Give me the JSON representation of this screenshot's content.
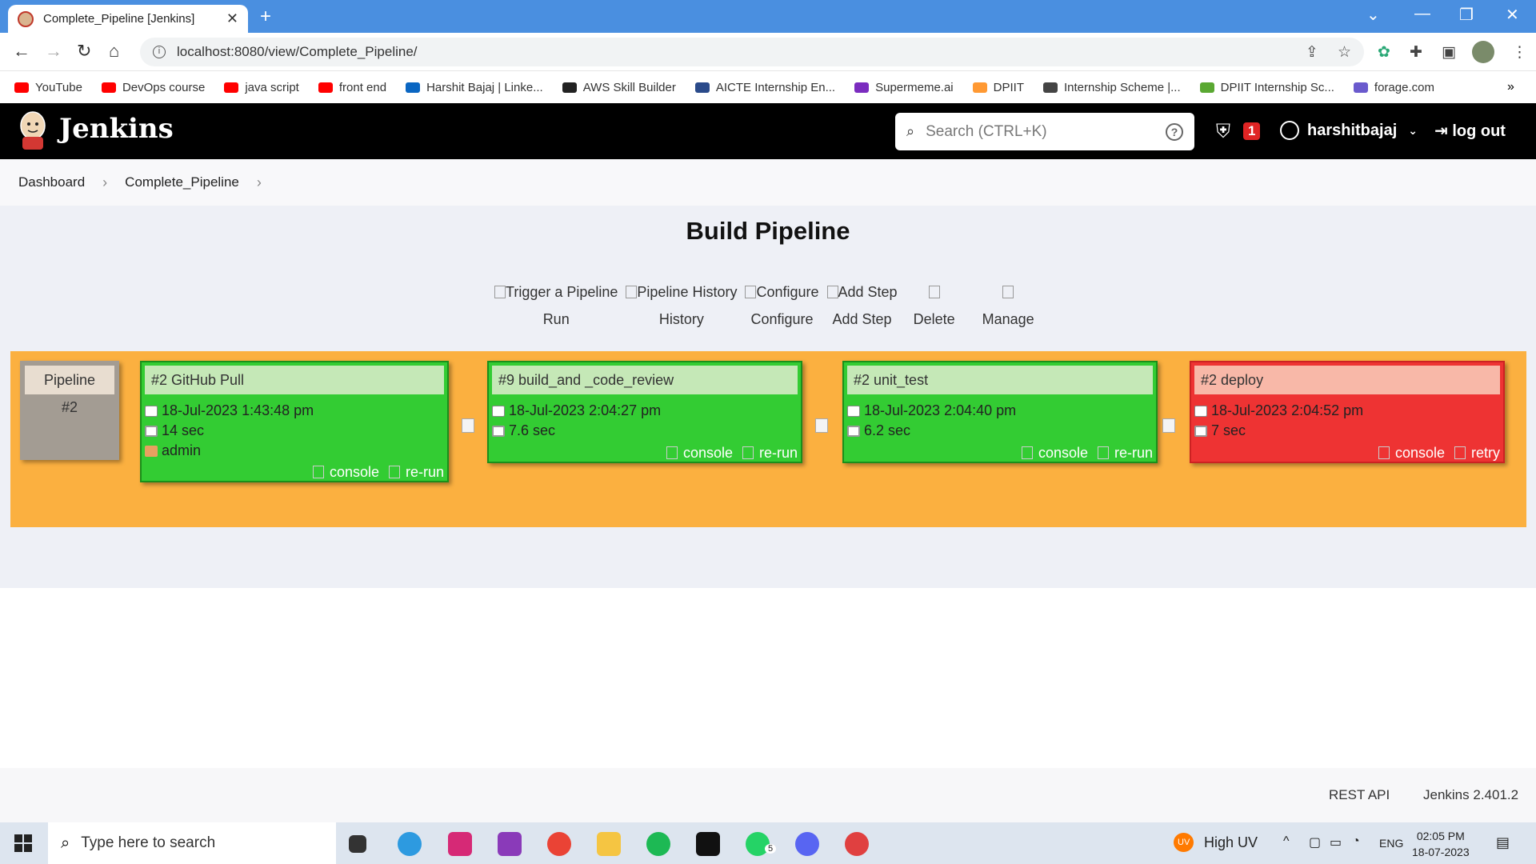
{
  "browser": {
    "tab_title": "Complete_Pipeline [Jenkins]",
    "url": "localhost:8080/view/Complete_Pipeline/",
    "bookmarks": [
      {
        "label": "YouTube",
        "color": "#ff0000"
      },
      {
        "label": "DevOps course",
        "color": "#ff0000"
      },
      {
        "label": "java script",
        "color": "#ff0000"
      },
      {
        "label": "front end",
        "color": "#ff0000"
      },
      {
        "label": "Harshit Bajaj | Linke...",
        "color": "#0a66c2"
      },
      {
        "label": "AWS Skill Builder",
        "color": "#222222"
      },
      {
        "label": "AICTE Internship En...",
        "color": "#2a4a8a"
      },
      {
        "label": "Supermeme.ai",
        "color": "#7b2cbf"
      },
      {
        "label": "DPIIT",
        "color": "#ff9933"
      },
      {
        "label": "Internship Scheme |...",
        "color": "#444444"
      },
      {
        "label": "DPIIT Internship Sc...",
        "color": "#5aa832"
      },
      {
        "label": "forage.com",
        "color": "#6a5acd"
      }
    ]
  },
  "jenkins": {
    "brand": "Jenkins",
    "search_placeholder": "Search (CTRL+K)",
    "security_count": "1",
    "username": "harshitbajaj",
    "logout": "log out"
  },
  "breadcrumb": {
    "items": [
      "Dashboard",
      "Complete_Pipeline"
    ]
  },
  "page": {
    "title": "Build Pipeline",
    "actions": [
      {
        "alt": "Trigger a Pipeline",
        "label": "Run"
      },
      {
        "alt": "Pipeline History",
        "label": "History"
      },
      {
        "alt": "Configure",
        "label": "Configure"
      },
      {
        "alt": "Add Step",
        "label": "Add Step"
      },
      {
        "alt": "",
        "label": "Delete"
      },
      {
        "alt": "",
        "label": "Manage"
      }
    ]
  },
  "pipeline": {
    "label": "Pipeline",
    "number": "#2",
    "stages": [
      {
        "name": "#2 GitHub Pull",
        "date": "18-Jul-2023 1:43:48 pm",
        "duration": "14 sec",
        "user": "admin",
        "status": "success",
        "buttons": [
          "console",
          "re-run"
        ]
      },
      {
        "name": "#9 build_and _code_review",
        "date": "18-Jul-2023 2:04:27 pm",
        "duration": "7.6 sec",
        "user": "",
        "status": "success",
        "buttons": [
          "console",
          "re-run"
        ]
      },
      {
        "name": "#2 unit_test",
        "date": "18-Jul-2023 2:04:40 pm",
        "duration": "6.2 sec",
        "user": "",
        "status": "success",
        "buttons": [
          "console",
          "re-run"
        ]
      },
      {
        "name": "#2 deploy",
        "date": "18-Jul-2023 2:04:52 pm",
        "duration": "7 sec",
        "user": "",
        "status": "failed",
        "buttons": [
          "console",
          "retry"
        ]
      }
    ]
  },
  "footer": {
    "rest_api": "REST API",
    "version": "Jenkins 2.401.2"
  },
  "taskbar": {
    "search_placeholder": "Type here to search",
    "weather": "High UV",
    "weather_badge": "UV",
    "language": "ENG",
    "time": "02:05 PM",
    "date": "18-07-2023",
    "whatsapp_badge": "5"
  },
  "colors": {
    "success": "#33cc33",
    "failed": "#ee3333",
    "pipeline_bg": "#fbb040",
    "header_bg": "#000000"
  }
}
